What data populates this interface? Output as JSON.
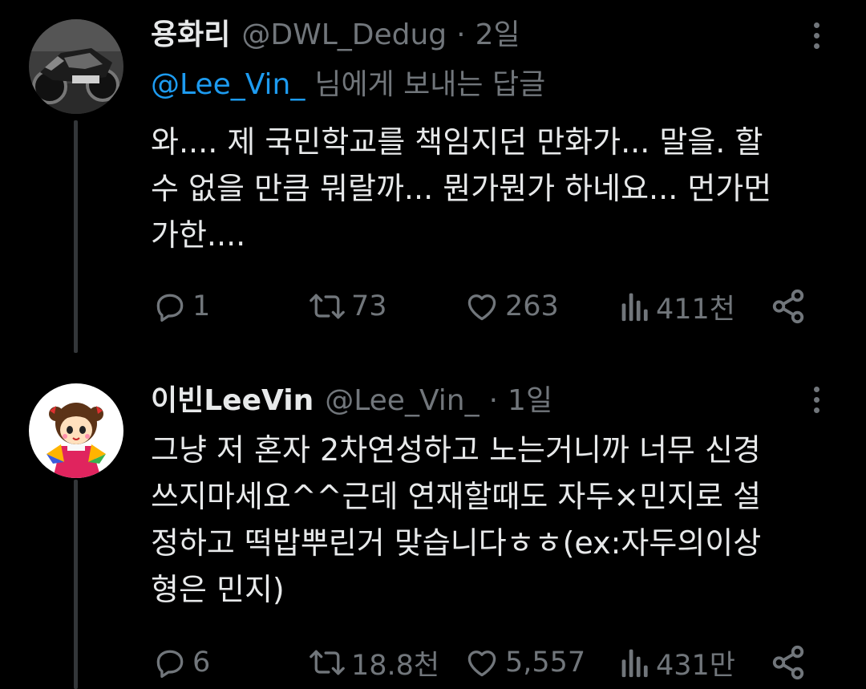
{
  "tweets": [
    {
      "display_name": "용화리",
      "handle": "@DWL_Dedug",
      "separator": "·",
      "time": "2일",
      "reply_to": {
        "mention": "@Lee_Vin_",
        "suffix": "님에게 보내는 답글"
      },
      "text": "와.... 제 국민학교를 책임지던 만화가... 말을. 할\n수 없을 만큼 뭐랄까... 뭔가뭔가 하네요... 먼가먼\n가한....",
      "stats": {
        "replies": "1",
        "retweets": "73",
        "likes": "263",
        "views": "411천"
      },
      "avatar_icon": "motorcycle-avatar"
    },
    {
      "display_name": "이빈LeeVin",
      "handle": "@Lee_Vin_",
      "separator": "·",
      "time": "1일",
      "text": "그냥 저 혼자 2차연성하고 노는거니까 너무 신경\n쓰지마세요^^근데 연재할때도 자두×민지로 설\n정하고 떡밥뿌린거 맞습니다ㅎㅎ(ex:자두의이상\n형은 민지)",
      "stats": {
        "replies": "6",
        "retweets": "18.8천",
        "likes": "5,557",
        "views": "431만"
      },
      "avatar_icon": "cartoon-girl-avatar"
    }
  ],
  "colors": {
    "background": "#000000",
    "text": "#e7e9ea",
    "muted": "#71767b",
    "link": "#1d9bf0",
    "thread_line": "#333639"
  }
}
